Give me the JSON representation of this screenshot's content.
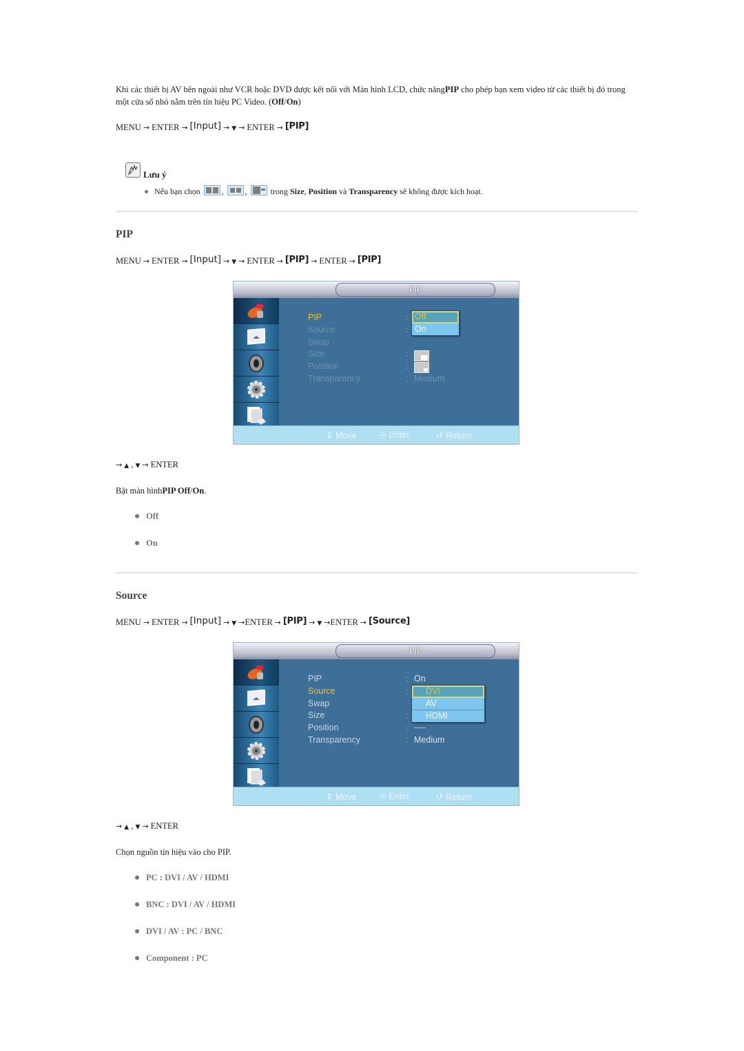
{
  "intro": {
    "text_before": "Khi các thiết bị AV bên ngoài như VCR hoặc DVD được kết nối với Màn hình LCD, chức năng",
    "text_bold": "PIP",
    "text_after": " cho phép bạn xem video từ các thiết bị đó trong một cửa sổ nhỏ nằm trên tín hiệu PC Video. (",
    "off": "Off",
    "slash": "/",
    "on": "On",
    "close": ")"
  },
  "path1": {
    "menu": "MENU",
    "enter": "ENTER",
    "input": "[Input]",
    "down": "▼",
    "enter2": "ENTER",
    "pip": "[PIP]",
    "arrow": "→"
  },
  "note": {
    "title": "Lưu ý",
    "text_before": "Nếu bạn chọn",
    "text_mid": "trong",
    "size": "Size",
    "position": "Position",
    "and": "và",
    "transparency": "Transparency",
    "text_after": "sẽ không được kích hoạt."
  },
  "section_pip": {
    "heading": "PIP",
    "path": {
      "menu": "MENU",
      "enter": "ENTER",
      "input": "[Input]",
      "down": "▼",
      "enter2": "ENTER",
      "pip": "[PIP]",
      "enter3": "ENTER",
      "pip2": "[PIP]",
      "arrow": "→"
    },
    "osd": {
      "title": "PIP",
      "items": [
        {
          "label": "PIP",
          "value": ""
        },
        {
          "label": "Source",
          "value": ""
        },
        {
          "label": "Swap",
          "value": ""
        },
        {
          "label": "Size",
          "value": ""
        },
        {
          "label": "Position",
          "value": ""
        },
        {
          "label": "Transparency",
          "value": "Medium"
        }
      ],
      "dropdown": [
        "Off",
        "On"
      ],
      "dropdown_selected": "Off",
      "footer": {
        "move": "Move",
        "enter": "Enter",
        "return": "Return"
      }
    },
    "nav": {
      "arrow": "→",
      "up": "▲",
      "comma": ",",
      "down": "▼",
      "enter": "ENTER"
    },
    "desc_before": "Bật màn hình",
    "desc_bold": "PIP Off",
    "desc_slash": "/",
    "desc_on": "On",
    "desc_end": ".",
    "options": [
      "Off",
      "On"
    ]
  },
  "section_source": {
    "heading": "Source",
    "path": {
      "menu": "MENU",
      "enter": "ENTER",
      "input": "[Input]",
      "down": "▼",
      "enter2": "ENTER",
      "pip": "[PIP]",
      "down2": "▼",
      "enter3": "ENTER",
      "source": "[Source]",
      "arrow": "→"
    },
    "osd": {
      "title": "PIP",
      "items": [
        {
          "label": "PIP",
          "value": "On"
        },
        {
          "label": "Source",
          "value": ""
        },
        {
          "label": "Swap",
          "value": ""
        },
        {
          "label": "Size",
          "value": ""
        },
        {
          "label": "Position",
          "value": "----"
        },
        {
          "label": "Transparency",
          "value": "Medium"
        }
      ],
      "dropdown": [
        "DVI",
        "AV",
        "HDMI"
      ],
      "dropdown_selected": "DVI",
      "footer": {
        "move": "Move",
        "enter": "Enter",
        "return": "Return"
      }
    },
    "nav": {
      "arrow": "→",
      "up": "▲",
      "comma": ",",
      "down": "▼",
      "enter": "ENTER"
    },
    "desc": "Chọn nguồn tín hiệu vào cho PIP.",
    "options": [
      {
        "main": "PC",
        "rest": " : DVI / AV / HDMI"
      },
      {
        "main": "BNC",
        "rest": " : DVI / AV / HDMI"
      },
      {
        "main": "DVI / AV",
        "rest": " : PC / BNC"
      },
      {
        "main": "Component",
        "rest": " : PC"
      }
    ]
  },
  "colors": {
    "osd_bg": "#3e6f99",
    "osd_selected": "#e8c02c",
    "dropdown_bg": "#7fc6ee",
    "footer_bg": "#aee0f2"
  }
}
